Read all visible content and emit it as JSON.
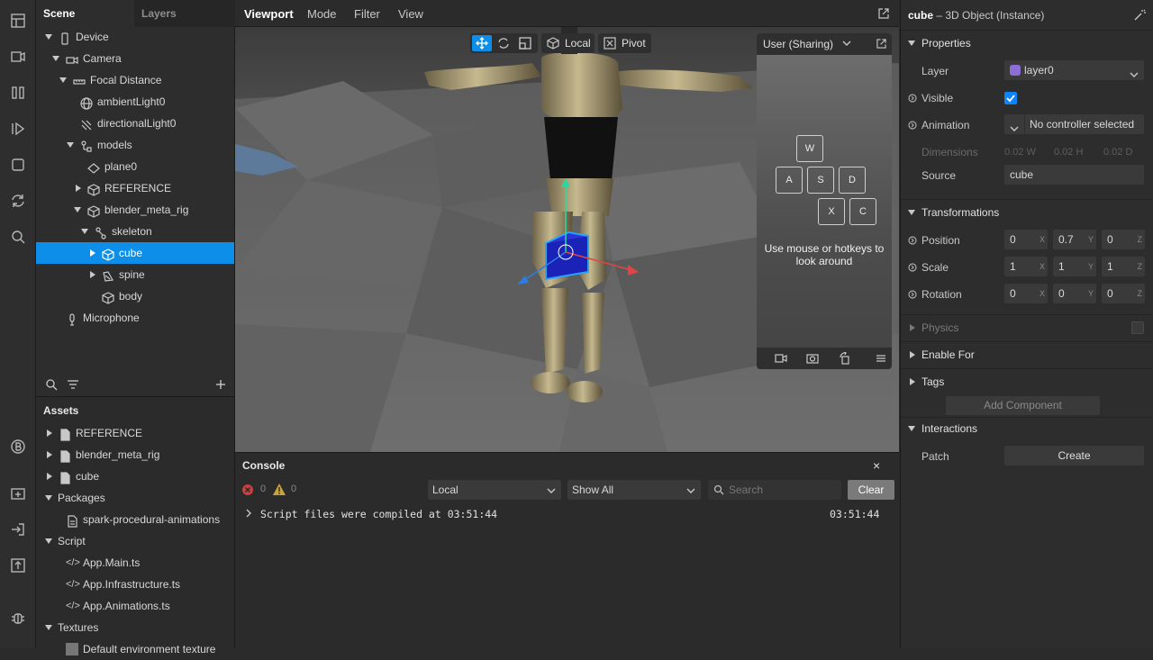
{
  "scene": {
    "tab_scene": "Scene",
    "tab_layers": "Layers",
    "tree": [
      {
        "label": "Device"
      },
      {
        "label": "Camera"
      },
      {
        "label": "Focal Distance"
      },
      {
        "label": "ambientLight0"
      },
      {
        "label": "directionalLight0"
      },
      {
        "label": "models"
      },
      {
        "label": "plane0"
      },
      {
        "label": "REFERENCE"
      },
      {
        "label": "blender_meta_rig"
      },
      {
        "label": "skeleton"
      },
      {
        "label": "cube"
      },
      {
        "label": "spine"
      },
      {
        "label": "body"
      },
      {
        "label": "Microphone"
      }
    ]
  },
  "assets": {
    "title": "Assets",
    "items": [
      {
        "label": "REFERENCE"
      },
      {
        "label": "blender_meta_rig"
      },
      {
        "label": "cube"
      },
      {
        "label": "Packages"
      },
      {
        "label": "spark-procedural-animations"
      },
      {
        "label": "Script"
      },
      {
        "label": "App.Main.ts"
      },
      {
        "label": "App.Infrastructure.ts"
      },
      {
        "label": "App.Animations.ts"
      },
      {
        "label": "Textures"
      },
      {
        "label": "Default environment texture"
      }
    ]
  },
  "viewport_menu": {
    "viewport": "Viewport",
    "mode": "Mode",
    "filter": "Filter",
    "view": "View"
  },
  "gizmo_bar": {
    "local": "Local",
    "pivot": "Pivot"
  },
  "preview": {
    "camera_label": "User (Sharing)",
    "keys": [
      "W",
      "A",
      "S",
      "D",
      "X",
      "C"
    ],
    "hint": "Use mouse or hotkeys to look around"
  },
  "console": {
    "title": "Console",
    "errors": "0",
    "warnings": "0",
    "scope": "Local",
    "filter": "Show All",
    "search_placeholder": "Search",
    "clear": "Clear",
    "message": "Script files were compiled at 03:51:44",
    "time": "03:51:44"
  },
  "inspector": {
    "object_name": "cube",
    "object_type": "– 3D Object (Instance)",
    "properties": "Properties",
    "layer_label": "Layer",
    "layer_value": "layer0",
    "layer_color": "#8b6fd6",
    "visible_label": "Visible",
    "animation_label": "Animation",
    "animation_value": "No controller selected",
    "dimensions_label": "Dimensions",
    "dim_w": "0.02 W",
    "dim_h": "0.02 H",
    "dim_d": "0.02 D",
    "source_label": "Source",
    "source_value": "cube",
    "transformations": "Transformations",
    "position_label": "Position",
    "position": [
      "0",
      "0.7",
      "0"
    ],
    "scale_label": "Scale",
    "scale": [
      "1",
      "1",
      "1"
    ],
    "rotation_label": "Rotation",
    "rotation": [
      "0",
      "0",
      "0"
    ],
    "axes": [
      "X",
      "Y",
      "Z"
    ],
    "physics": "Physics",
    "enable_for": "Enable For",
    "tags": "Tags",
    "add_component": "Add Component",
    "interactions": "Interactions",
    "patch_label": "Patch",
    "create": "Create"
  },
  "colors": {
    "selection": "#0d8fe9",
    "accent": "#0a84ff"
  }
}
